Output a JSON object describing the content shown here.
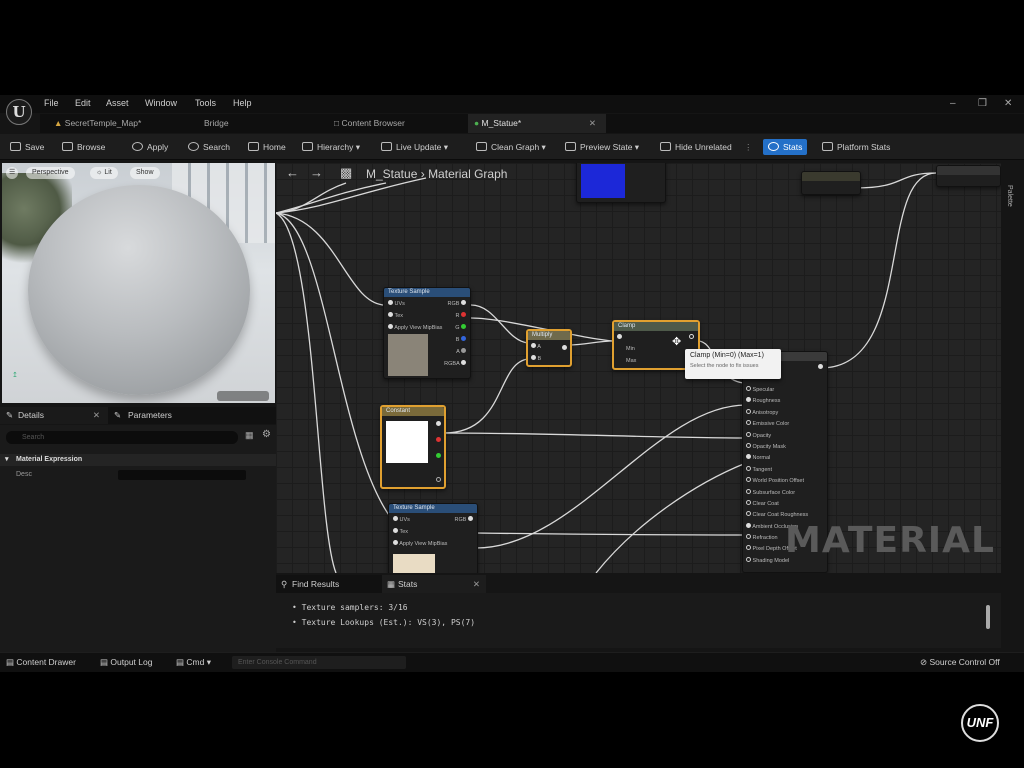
{
  "app": {
    "logo": "U",
    "menu": [
      "File",
      "Edit",
      "Asset",
      "Window",
      "Tools",
      "Help"
    ],
    "window_controls": [
      "–",
      "❒",
      "✕"
    ]
  },
  "tabs": [
    {
      "label": "SecretTemple_Map*"
    },
    {
      "label": "Bridge"
    },
    {
      "label": "Content Browser"
    },
    {
      "label": "M_Statue*",
      "active": true
    }
  ],
  "toolbar": {
    "save": "Save",
    "browse": "Browse",
    "apply": "Apply",
    "search": "Search",
    "home": "Home",
    "hierarchy": "Hierarchy ▾",
    "live_update": "Live Update ▾",
    "clean_graph": "Clean Graph ▾",
    "preview_state": "Preview State ▾",
    "hide_unrelated": "Hide Unrelated",
    "stats": "Stats",
    "platform_stats": "Platform Stats"
  },
  "viewport": {
    "perspective": "Perspective",
    "lit": "Lit",
    "show": "Show"
  },
  "details_panel": {
    "tab_details": "Details",
    "tab_parameters": "Parameters",
    "search_placeholder": "Search",
    "section": "Material Expression",
    "prop_label": "Desc"
  },
  "graph": {
    "breadcrumb_root": "M_Statue",
    "breadcrumb_separator": "›",
    "breadcrumb_current": "Material Graph",
    "watermark": "MATERIAL",
    "palette": "Palette",
    "texture_sample_1": {
      "title": "Texture Sample",
      "pins": [
        "UVs",
        "Tex",
        "Apply View MipBias"
      ],
      "outputs": [
        "RGB",
        "R",
        "G",
        "B",
        "A",
        "RGBA"
      ]
    },
    "multiply": {
      "title": "Multiply",
      "pins": [
        "A",
        "B"
      ]
    },
    "clamp": {
      "title": "Clamp",
      "pins": [
        "Min",
        "Max"
      ]
    },
    "constant": {
      "title": "Constant"
    },
    "texture_sample_2": {
      "title": "Texture Sample",
      "pins": [
        "UVs",
        "Tex",
        "Apply View MipBias"
      ],
      "outputs": [
        "RGB"
      ]
    },
    "result_node": {
      "pins": [
        "Specular",
        "Roughness",
        "Anisotropy",
        "Emissive Color",
        "Opacity",
        "Opacity Mask",
        "Normal",
        "Tangent",
        "World Position Offset",
        "Subsurface Color",
        "Clear Coat",
        "Clear Coat Roughness",
        "Ambient Occlusion",
        "Refraction",
        "Pixel Depth Offset",
        "Shading Model"
      ]
    },
    "tooltip": {
      "title": "Clamp (Min=0) (Max=1)",
      "subtitle": "Select the node to fix issues"
    }
  },
  "bottom_panel": {
    "tab_find": "Find Results",
    "tab_stats": "Stats",
    "lines": [
      "• Texture samplers: 3/16",
      "• Texture Lookups (Est.): VS(3), PS(7)"
    ]
  },
  "statusbar": {
    "content_drawer": "Content Drawer",
    "output_log": "Output Log",
    "cmd": "Cmd ▾",
    "cmd_placeholder": "Enter Console Command",
    "source_control": "Source Control Off"
  },
  "overlay": {
    "brand": "UNF"
  },
  "colors": {
    "accent_blue": "#2470c8",
    "selection_orange": "#e0a030",
    "texture_header": "#2a4e78",
    "multiply_header": "#6f6a4c",
    "constant_header": "#7a6a3a"
  }
}
